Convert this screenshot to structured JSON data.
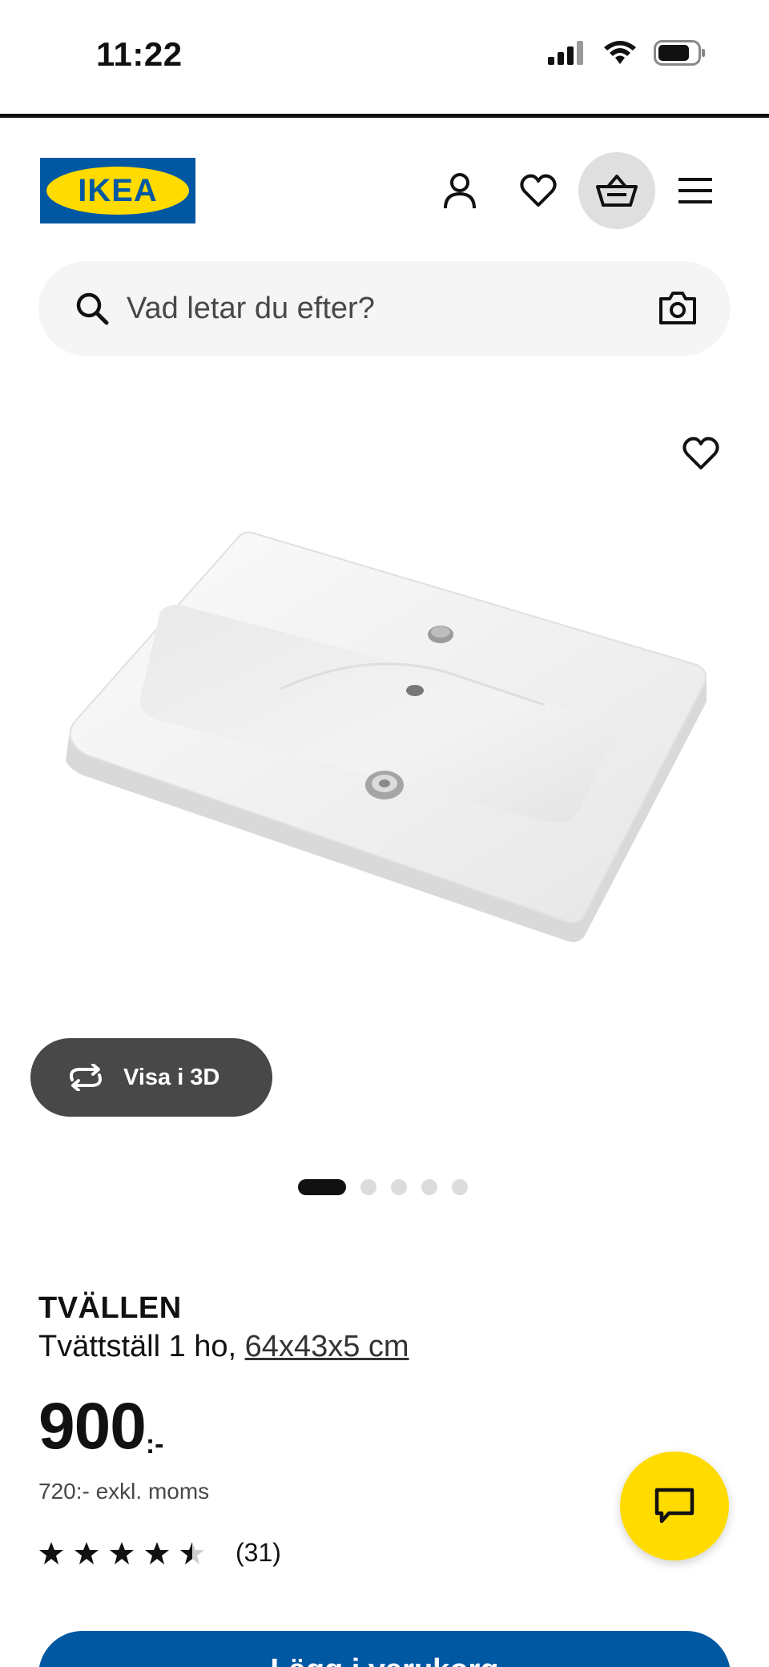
{
  "status_bar": {
    "time": "11:22"
  },
  "header": {
    "logo_text": "IKEA",
    "icons": [
      "profile-icon",
      "heart-icon",
      "basket-icon",
      "menu-icon"
    ]
  },
  "search": {
    "placeholder": "Vad letar du efter?"
  },
  "gallery": {
    "view_3d_label": "Visa i 3D",
    "slide_count": 5,
    "active_slide": 1
  },
  "product": {
    "name": "TVÄLLEN",
    "description": "Tvättställ 1 ho, ",
    "size": "64x43x5 cm",
    "price": "900",
    "price_suffix": ":-",
    "price_ex_vat": "720:- exkl. moms",
    "rating": 4.5,
    "rating_count": "(31)"
  },
  "cta": {
    "label": "Lägg i varukorg"
  },
  "colors": {
    "brand_blue": "#0058a3",
    "brand_yellow": "#ffdb00",
    "dark_button": "#484848"
  }
}
